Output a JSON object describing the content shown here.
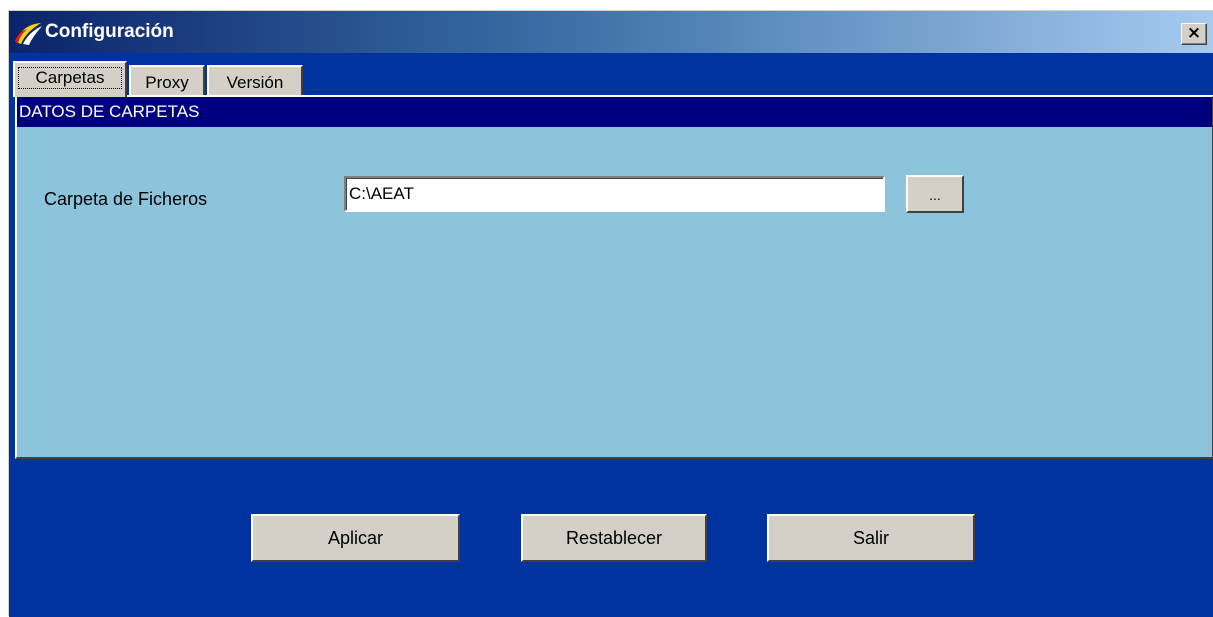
{
  "window": {
    "title": "Configuración",
    "close_label": "×"
  },
  "tabs": [
    {
      "label": "Carpetas",
      "active": true
    },
    {
      "label": "Proxy",
      "active": false
    },
    {
      "label": "Versión",
      "active": false
    }
  ],
  "section": {
    "header": "DATOS DE CARPETAS"
  },
  "folder": {
    "label": "Carpeta de Ficheros",
    "value": "C:\\AEAT",
    "browse_label": "..."
  },
  "actions": {
    "apply_label": "Aplicar",
    "reset_label": "Restablecer",
    "exit_label": "Salir"
  },
  "colors": {
    "title_gradient_start": "#0a246a",
    "client_background": "#0033a0",
    "panel_background": "#8cc4dc",
    "section_header": "#00007f"
  },
  "icons": {
    "title": "aeat-logo-icon"
  }
}
